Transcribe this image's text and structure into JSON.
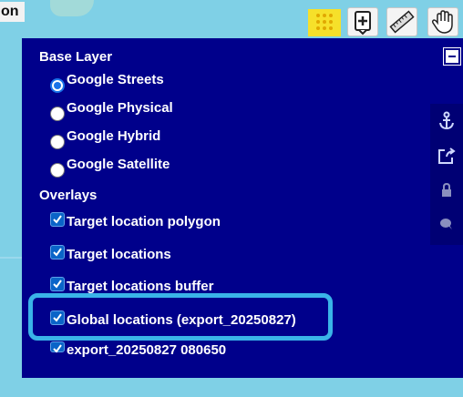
{
  "map": {
    "title_fragment": "on"
  },
  "toolbar": {
    "tools": [
      {
        "name": "grid-icon",
        "color": "#f6e02a"
      },
      {
        "name": "zoom-box-icon"
      },
      {
        "name": "ruler-icon"
      },
      {
        "name": "hand-icon"
      }
    ]
  },
  "layer_switcher": {
    "base_layer_title": "Base Layer",
    "base_layers": [
      {
        "label": "Google Streets",
        "selected": true
      },
      {
        "label": "Google Physical",
        "selected": false
      },
      {
        "label": "Google Hybrid",
        "selected": false
      },
      {
        "label": "Google Satellite",
        "selected": false
      }
    ],
    "overlays_title": "Overlays",
    "overlays": [
      {
        "label": "Target location polygon",
        "checked": true
      },
      {
        "label": "Target locations",
        "checked": true
      },
      {
        "label": "Target locations buffer",
        "checked": true
      },
      {
        "label": "Global locations (export_20250827)",
        "checked": true
      },
      {
        "label": "export_20250827 080650",
        "checked": true
      }
    ],
    "panel_color": "#00008b",
    "highlight_color": "#3ab4e8"
  },
  "side_tools": [
    {
      "name": "anchor-icon"
    },
    {
      "name": "share-icon"
    },
    {
      "name": "lock-icon"
    },
    {
      "name": "bubble-icon"
    }
  ]
}
